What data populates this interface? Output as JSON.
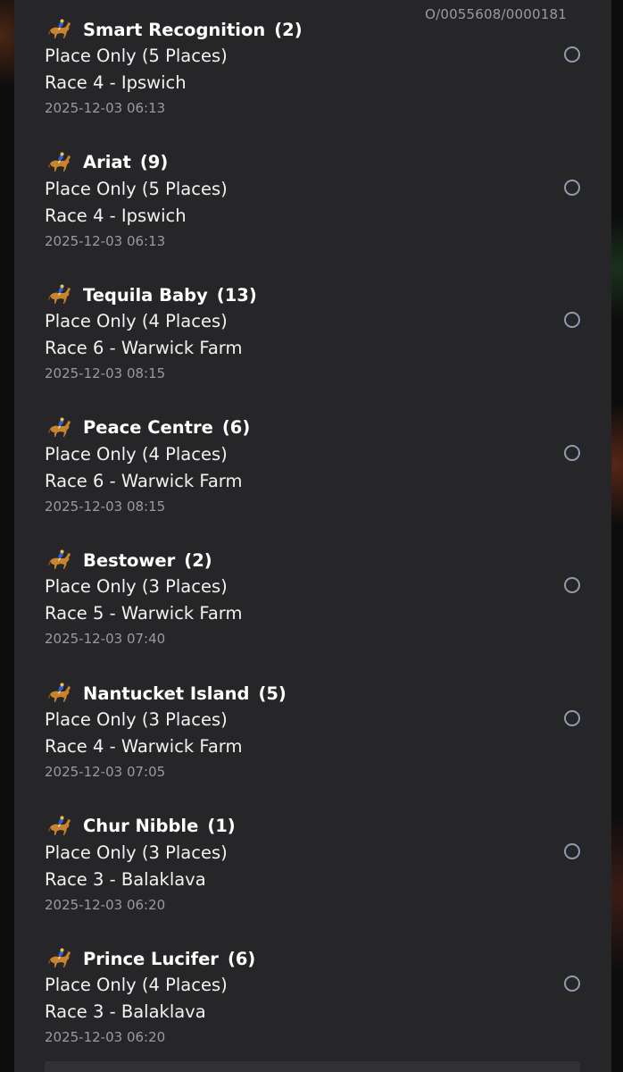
{
  "order_reference": "O/0055608/0000181",
  "icon": "horse-racing-icon",
  "bets": [
    {
      "runner": "Smart Recognition",
      "number": "(2)",
      "bet_type": "Place Only (5 Places)",
      "race": "Race 4 - Ipswich",
      "time": "2025-12-03 06:13"
    },
    {
      "runner": "Ariat",
      "number": "(9)",
      "bet_type": "Place Only (5 Places)",
      "race": "Race 4 - Ipswich",
      "time": "2025-12-03 06:13"
    },
    {
      "runner": "Tequila Baby",
      "number": "(13)",
      "bet_type": "Place Only (4 Places)",
      "race": "Race 6 - Warwick Farm",
      "time": "2025-12-03 08:15"
    },
    {
      "runner": "Peace Centre",
      "number": "(6)",
      "bet_type": "Place Only (4 Places)",
      "race": "Race 6 - Warwick Farm",
      "time": "2025-12-03 08:15"
    },
    {
      "runner": "Bestower",
      "number": "(2)",
      "bet_type": "Place Only (3 Places)",
      "race": "Race 5 - Warwick Farm",
      "time": "2025-12-03 07:40"
    },
    {
      "runner": "Nantucket Island",
      "number": "(5)",
      "bet_type": "Place Only (3 Places)",
      "race": "Race 4 - Warwick Farm",
      "time": "2025-12-03 07:05"
    },
    {
      "runner": "Chur Nibble",
      "number": "(1)",
      "bet_type": "Place Only (3 Places)",
      "race": "Race 3 - Balaklava",
      "time": "2025-12-03 06:20"
    },
    {
      "runner": "Prince Lucifer",
      "number": "(6)",
      "bet_type": "Place Only (4 Places)",
      "race": "Race 3 - Balaklava",
      "time": "2025-12-03 06:20"
    }
  ],
  "colors": {
    "sheet_bg": "#262628",
    "primary_text": "#ffffff",
    "secondary_text": "#9a9aa0",
    "radio_border": "#8e9bb0",
    "horse_body": "#c8842c",
    "jockey_silks": "#2f5fd8"
  }
}
